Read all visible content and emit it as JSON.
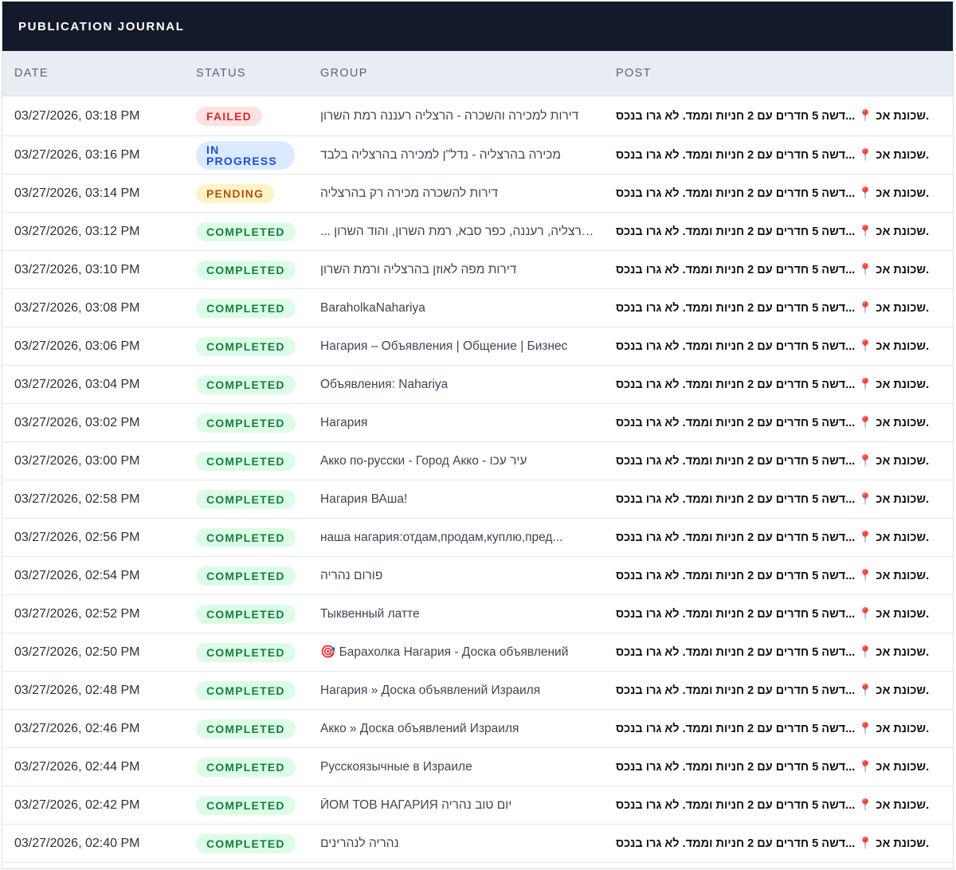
{
  "title": "PUBLICATION JOURNAL",
  "columns": {
    "date": "DATE",
    "status": "STATUS",
    "group": "GROUP",
    "post": "POST"
  },
  "status_colors": {
    "completed": "#15803d",
    "failed": "#dc2626",
    "pending": "#b45309",
    "in_progress": "#1d4ed8"
  },
  "rows": [
    {
      "date": "03/27/2026, 03:18 PM",
      "status": "FAILED",
      "status_kind": "failed",
      "group": "דירות למכירה והשכרה - הרצליה רעננה רמת השרון",
      "post": "שכונת אכ 📍 ...דשה 5 חדרים עם 2 חניות וממד. לא גרו בנכס."
    },
    {
      "date": "03/27/2026, 03:16 PM",
      "status": "IN PROGRESS",
      "status_kind": "inprogress",
      "group": "מכירה בהרצליה - נדל\"ן למכירה בהרצליה בלבד",
      "post": "שכונת אכ 📍 ...דשה 5 חדרים עם 2 חניות וממד. לא גרו בנכס."
    },
    {
      "date": "03/27/2026, 03:14 PM",
      "status": "PENDING",
      "status_kind": "pending",
      "group": "דירות להשכרה מכירה רק בהרצליה",
      "post": "שכונת אכ 📍 ...דשה 5 חדרים עם 2 חניות וממד. לא גרו בנכס."
    },
    {
      "date": "03/27/2026, 03:12 PM",
      "status": "COMPLETED",
      "status_kind": "completed",
      "group": "... בהרצליה, רעננה, כפר סבא, רמת השרון, והוד השרון",
      "post": "שכונת אכ 📍 ...דשה 5 חדרים עם 2 חניות וממד. לא גרו בנכס."
    },
    {
      "date": "03/27/2026, 03:10 PM",
      "status": "COMPLETED",
      "status_kind": "completed",
      "group": "דירות מפה לאוזן בהרצליה ורמת השרון",
      "post": "שכונת אכ 📍 ...דשה 5 חדרים עם 2 חניות וממד. לא גרו בנכס."
    },
    {
      "date": "03/27/2026, 03:08 PM",
      "status": "COMPLETED",
      "status_kind": "completed",
      "group": "BaraholkaNahariya",
      "post": "שכונת אכ 📍 ...דשה 5 חדרים עם 2 חניות וממד. לא גרו בנכס."
    },
    {
      "date": "03/27/2026, 03:06 PM",
      "status": "COMPLETED",
      "status_kind": "completed",
      "group": "Нагария – Объявления | Общение | Бизнес",
      "post": "שכונת אכ 📍 ...דשה 5 חדרים עם 2 חניות וממד. לא גרו בנכס."
    },
    {
      "date": "03/27/2026, 03:04 PM",
      "status": "COMPLETED",
      "status_kind": "completed",
      "group": "Объявления: Nahariya",
      "post": "שכונת אכ 📍 ...דשה 5 חדרים עם 2 חניות וממד. לא גרו בנכס."
    },
    {
      "date": "03/27/2026, 03:02 PM",
      "status": "COMPLETED",
      "status_kind": "completed",
      "group": "Нагария",
      "post": "שכונת אכ 📍 ...דשה 5 חדרים עם 2 חניות וממד. לא גרו בנכס."
    },
    {
      "date": "03/27/2026, 03:00 PM",
      "status": "COMPLETED",
      "status_kind": "completed",
      "group": "Акко по-русски - Город Акко - עיר עכו",
      "post": "שכונת אכ 📍 ...דשה 5 חדרים עם 2 חניות וממד. לא גרו בנכס."
    },
    {
      "date": "03/27/2026, 02:58 PM",
      "status": "COMPLETED",
      "status_kind": "completed",
      "group": "Нагария ВАша!",
      "post": "שכונת אכ 📍 ...דשה 5 חדרים עם 2 חניות וממד. לא גרו בנכס."
    },
    {
      "date": "03/27/2026, 02:56 PM",
      "status": "COMPLETED",
      "status_kind": "completed",
      "group": "наша нагария:отдам,продам,куплю,пред...",
      "post": "שכונת אכ 📍 ...דשה 5 חדרים עם 2 חניות וממד. לא גרו בנכס."
    },
    {
      "date": "03/27/2026, 02:54 PM",
      "status": "COMPLETED",
      "status_kind": "completed",
      "group": "פורום נהריה",
      "post": "שכונת אכ 📍 ...דשה 5 חדרים עם 2 חניות וממד. לא גרו בנכס."
    },
    {
      "date": "03/27/2026, 02:52 PM",
      "status": "COMPLETED",
      "status_kind": "completed",
      "group": "Тыквенный латте",
      "post": "שכונת אכ 📍 ...דשה 5 חדרים עם 2 חניות וממד. לא גרו בנכס."
    },
    {
      "date": "03/27/2026, 02:50 PM",
      "status": "COMPLETED",
      "status_kind": "completed",
      "group": "🎯 Барахолка Нагария - Доска объявлений",
      "post": "שכונת אכ 📍 ...דשה 5 חדרים עם 2 חניות וממד. לא גרו בנכס."
    },
    {
      "date": "03/27/2026, 02:48 PM",
      "status": "COMPLETED",
      "status_kind": "completed",
      "group": "Нагария » Доска объявлений Израиля",
      "post": "שכונת אכ 📍 ...דשה 5 חדרים עם 2 חניות וממד. לא גרו בנכס."
    },
    {
      "date": "03/27/2026, 02:46 PM",
      "status": "COMPLETED",
      "status_kind": "completed",
      "group": "Акко » Доска объявлений Израиля",
      "post": "שכונת אכ 📍 ...דשה 5 חדרים עם 2 חניות וממד. לא גרו בנכס."
    },
    {
      "date": "03/27/2026, 02:44 PM",
      "status": "COMPLETED",
      "status_kind": "completed",
      "group": "Русскоязычные в Израиле",
      "post": "שכונת אכ 📍 ...דשה 5 חדרים עם 2 חניות וממד. לא גרו בנכס."
    },
    {
      "date": "03/27/2026, 02:42 PM",
      "status": "COMPLETED",
      "status_kind": "completed",
      "group": "ЙОМ ТОВ НАГАРИЯ יום טוב נהריה",
      "post": "שכונת אכ 📍 ...דשה 5 חדרים עם 2 חניות וממד. לא גרו בנכס."
    },
    {
      "date": "03/27/2026, 02:40 PM",
      "status": "COMPLETED",
      "status_kind": "completed",
      "group": "נהריה לנהרינים",
      "post": "שכונת אכ 📍 ...דשה 5 חדרים עם 2 חניות וממד. לא גרו בנכס."
    }
  ]
}
